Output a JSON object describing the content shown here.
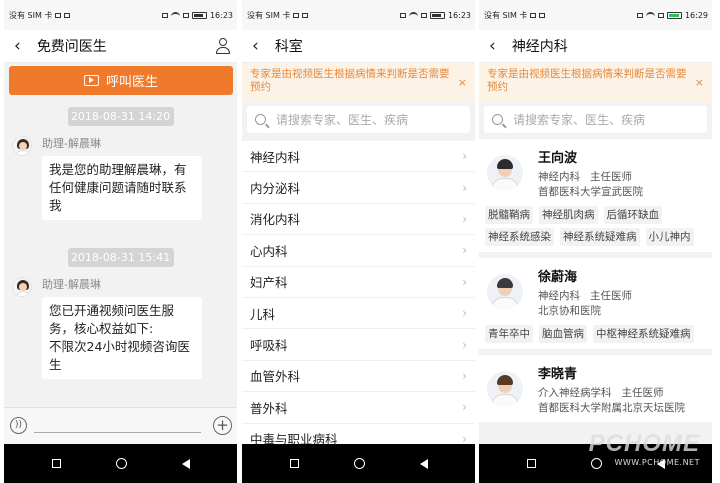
{
  "status_bars": [
    {
      "carrier": "没有 SIM 卡",
      "time": "16:23"
    },
    {
      "carrier": "没有 SIM 卡",
      "time": "16:23"
    },
    {
      "carrier": "没有 SIM 卡",
      "time": "16:29"
    }
  ],
  "screen1": {
    "title": "免费问医生",
    "call_button": "呼叫医生",
    "messages": [
      {
        "time": "2018-08-31 14:20",
        "sender": "助理-解晨琳",
        "text": "我是您的助理解晨琳，有任何健康问题请随时联系我"
      },
      {
        "time": "2018-08-31 15:41",
        "sender": "助理-解晨琳",
        "text": "您已开通视频问医生服务，核心权益如下:\n不限次24小时视频咨询医生"
      }
    ],
    "input_placeholder": ""
  },
  "screen2": {
    "title": "科室",
    "notice": "专家是由视频医生根据病情来判断是否需要预约",
    "search_placeholder": "请搜索专家、医生、疾病",
    "departments": [
      "神经内科",
      "内分泌科",
      "消化内科",
      "心内科",
      "妇产科",
      "儿科",
      "呼吸科",
      "血管外科",
      "普外科",
      "中毒与职业病科"
    ]
  },
  "screen3": {
    "title": "神经内科",
    "notice": "专家是由视频医生根据病情来判断是否需要预约",
    "search_placeholder": "请搜索专家、医生、疾病",
    "doctors": [
      {
        "name": "王向波",
        "dept_title": "神经内科   主任医师",
        "hospital": "首都医科大学宣武医院",
        "tags": [
          "脱髓鞘病",
          "神经肌肉病",
          "后循环缺血",
          "神经系统感染",
          "神经系统疑难病",
          "小儿神内"
        ],
        "hair": "#2b2b2b"
      },
      {
        "name": "徐蔚海",
        "dept_title": "神经内科   主任医师",
        "hospital": "北京协和医院",
        "tags": [
          "青年卒中",
          "脑血管病",
          "中枢神经系统疑难病"
        ],
        "hair": "#3a3a3a"
      },
      {
        "name": "李晓青",
        "dept_title": "介入神经病学科   主任医师",
        "hospital": "首都医科大学附属北京天坛医院",
        "tags": [],
        "hair": "#5a3a24"
      }
    ]
  },
  "close_symbol": "×",
  "chevron_symbol": "›",
  "back_symbol": "‹",
  "watermark": {
    "logo": "PCHOME",
    "url": "WWW.PCHOME.NET"
  }
}
